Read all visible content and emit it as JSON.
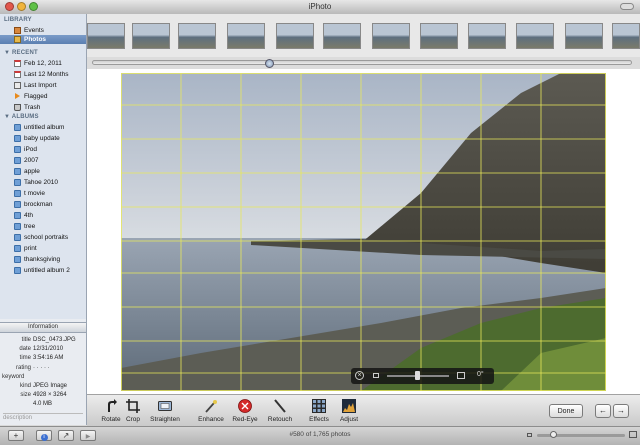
{
  "window": {
    "title": "iPhoto"
  },
  "sidebar": {
    "sections": [
      {
        "label": "LIBRARY",
        "items": [
          {
            "label": "Events",
            "icon": "events-icon",
            "selected": false
          },
          {
            "label": "Photos",
            "icon": "photos-icon",
            "selected": true
          }
        ]
      },
      {
        "label": "RECENT",
        "items": [
          {
            "label": "Feb 12, 2011",
            "icon": "calendar-icon"
          },
          {
            "label": "Last 12 Months",
            "icon": "calendar-icon"
          },
          {
            "label": "Last Import",
            "icon": "import-icon"
          },
          {
            "label": "Flagged",
            "icon": "flag-icon"
          },
          {
            "label": "Trash",
            "icon": "trash-icon"
          }
        ]
      },
      {
        "label": "ALBUMS",
        "items": [
          {
            "label": "untitled album",
            "icon": "album-icon"
          },
          {
            "label": "baby update",
            "icon": "album-icon"
          },
          {
            "label": "iPod",
            "icon": "album-icon"
          },
          {
            "label": "2007",
            "icon": "album-icon"
          },
          {
            "label": "apple",
            "icon": "album-icon"
          },
          {
            "label": "Tahoe 2010",
            "icon": "album-icon"
          },
          {
            "label": "t movie",
            "icon": "album-icon"
          },
          {
            "label": "brockman",
            "icon": "album-icon"
          },
          {
            "label": "4th",
            "icon": "album-icon"
          },
          {
            "label": "tree",
            "icon": "album-icon"
          },
          {
            "label": "school portraits",
            "icon": "album-icon"
          },
          {
            "label": "print",
            "icon": "album-icon"
          },
          {
            "label": "thanksgiving",
            "icon": "album-icon"
          },
          {
            "label": "untitled album 2",
            "icon": "album-icon"
          }
        ]
      }
    ]
  },
  "info": {
    "header": "Information",
    "rows": [
      {
        "key": "title",
        "value": "DSC_0473.JPG"
      },
      {
        "key": "date",
        "value": "12/31/2010"
      },
      {
        "key": "time",
        "value": "3:54:16 AM"
      },
      {
        "key": "rating",
        "value": "· · · · ·"
      },
      {
        "key": "keyword",
        "value": ""
      },
      {
        "key": "kind",
        "value": "JPEG Image"
      },
      {
        "key": "size",
        "value": "4928 × 3264"
      },
      {
        "key": "",
        "value": "4.0 MB"
      }
    ],
    "description_placeholder": "description"
  },
  "thumbnails": {
    "count": 11
  },
  "straighten": {
    "degree_label": "0°"
  },
  "toolbar": {
    "tools": [
      {
        "label": "Rotate",
        "icon": "rotate-icon"
      },
      {
        "label": "Crop",
        "icon": "crop-icon"
      },
      {
        "label": "Straighten",
        "icon": "straighten-icon"
      },
      {
        "label": "Enhance",
        "icon": "enhance-icon"
      },
      {
        "label": "Red-Eye",
        "icon": "red-eye-icon"
      },
      {
        "label": "Retouch",
        "icon": "retouch-icon"
      },
      {
        "label": "Effects",
        "icon": "effects-icon"
      },
      {
        "label": "Adjust",
        "icon": "adjust-icon"
      }
    ],
    "done_label": "Done"
  },
  "statusbar": {
    "text": "#580 of 1,765 photos",
    "zoom_level": 0.18
  },
  "colors": {
    "selection": "#5b7fb1",
    "grid": "#e8e85a",
    "red_eye": "#d42a2a"
  }
}
